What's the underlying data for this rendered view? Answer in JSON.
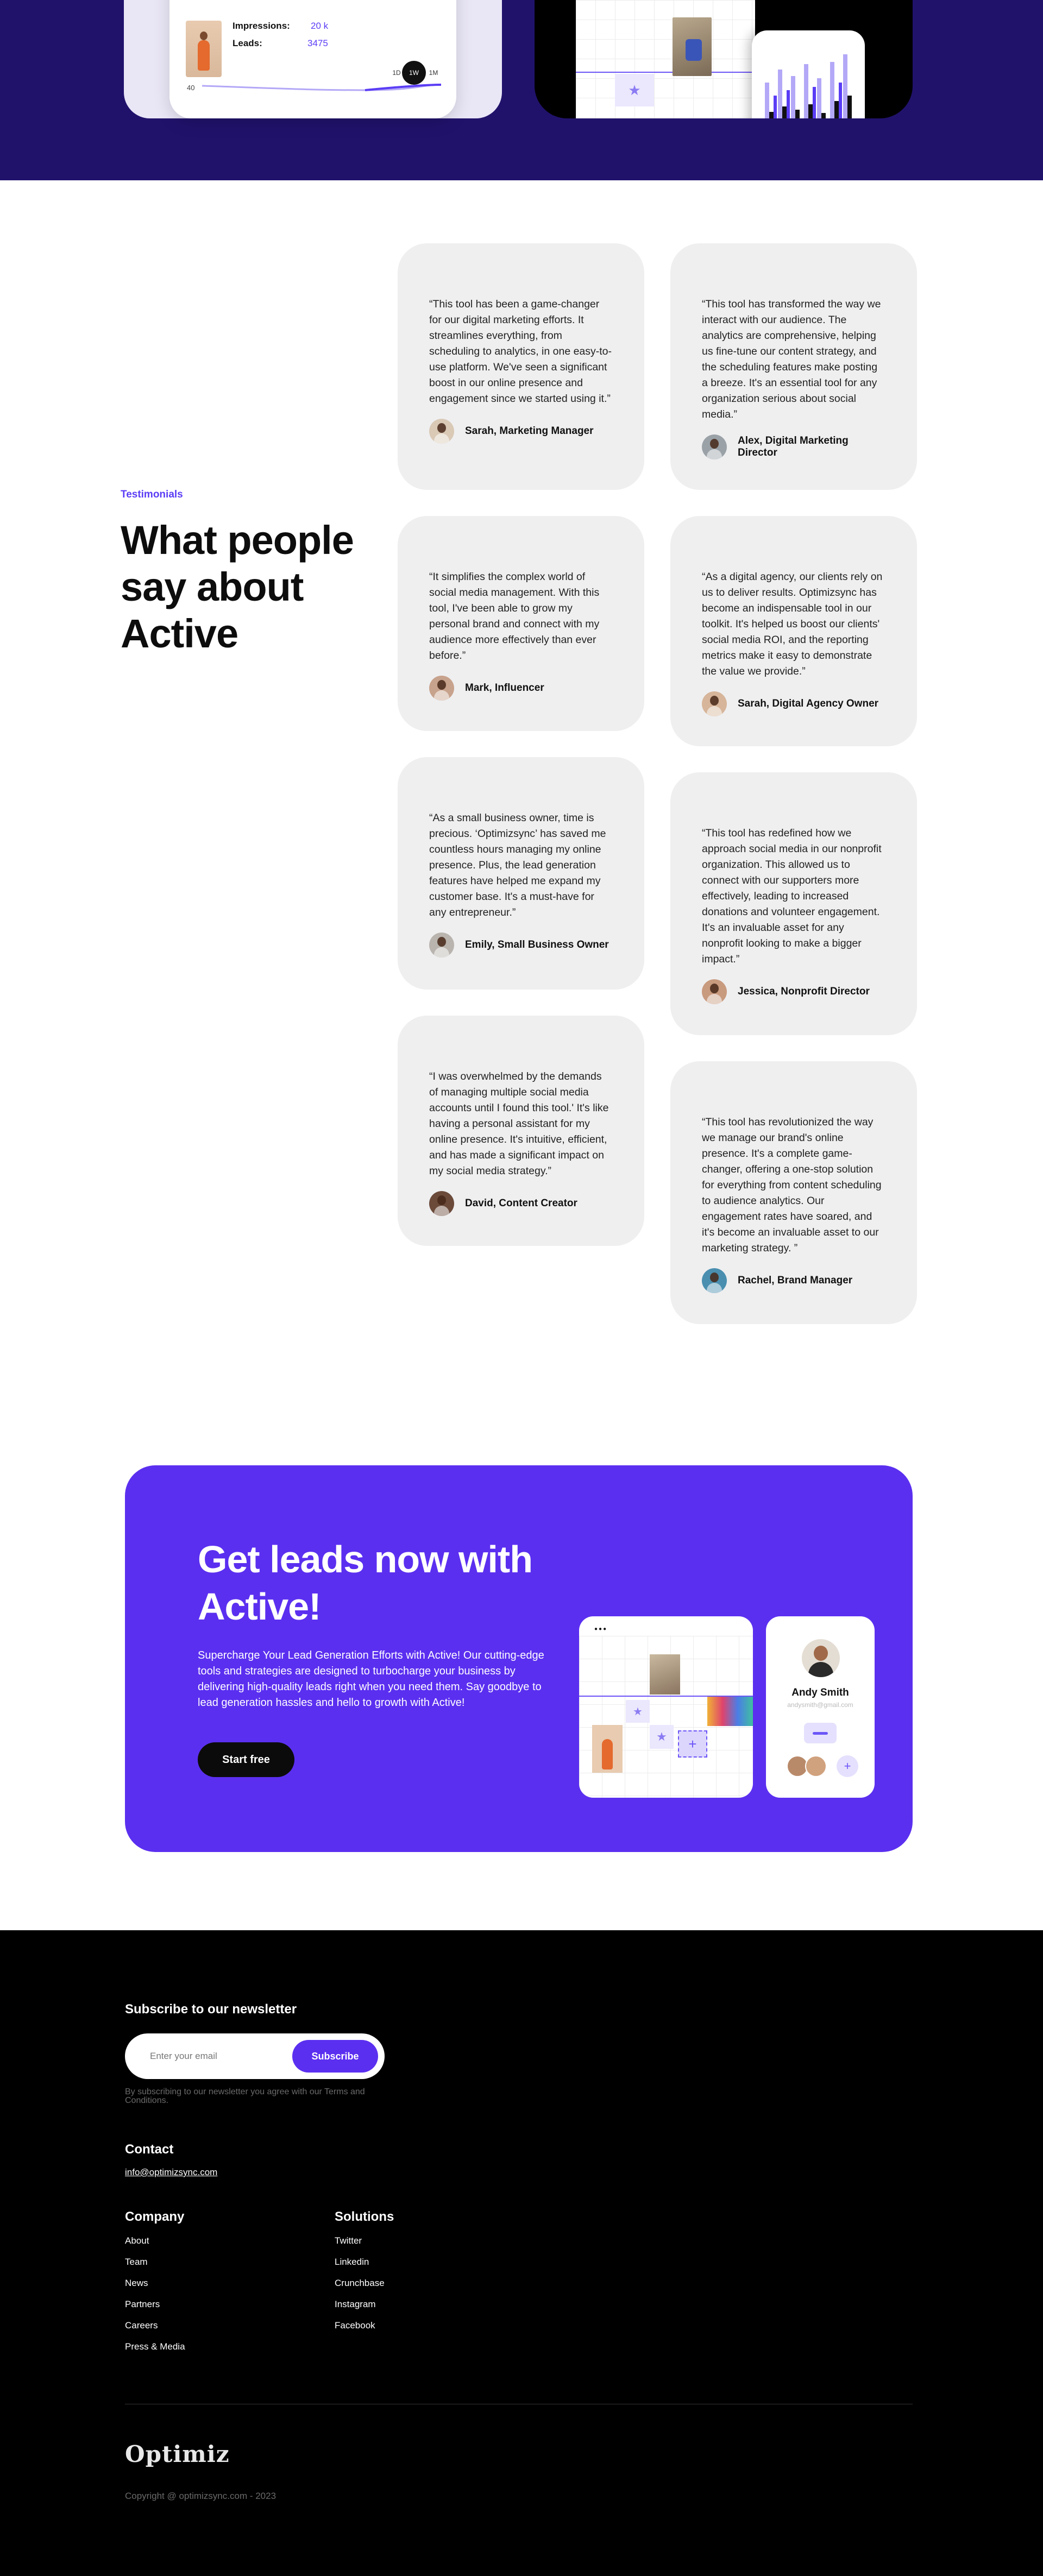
{
  "hero_preview": {
    "impressions_label": "Impressions:",
    "impressions_value": "20 k",
    "leads_label": "Leads:",
    "leads_value": "3475",
    "range_tabs": [
      "1D",
      "1W",
      "1M"
    ],
    "range_active": "1W",
    "axis_value": "40"
  },
  "testimonials": {
    "eyebrow": "Testimonials",
    "title": "What people say about Active",
    "items": [
      {
        "quote": "“This tool has been a game-changer for our digital marketing efforts. It streamlines everything, from scheduling to analytics, in one easy-to-use platform. We've seen a significant boost in our online presence and engagement since we started using it.”",
        "name": "Sarah, Marketing Manager",
        "avatar_color": "#d9c9b5"
      },
      {
        "quote": "“This tool has transformed the way we interact with our audience. The analytics are comprehensive, helping us fine-tune our content strategy, and the scheduling features make posting a breeze. It's an essential tool for any organization serious about social media.”",
        "name": "Alex, Digital Marketing Director",
        "avatar_color": "#9aa2a8"
      },
      {
        "quote": "“It simplifies the complex world of social media management. With this tool, I've been able to grow my personal brand and connect with my audience more effectively than ever before.”",
        "name": "Mark, Influencer",
        "avatar_color": "#c7a28c"
      },
      {
        "quote": "“As a digital agency, our clients rely on us to deliver results. Optimizsync has become an indispensable tool in our toolkit. It's helped us boost our clients' social media ROI, and the reporting metrics make it easy to demonstrate the value we provide.”",
        "name": "Sarah, Digital Agency Owner",
        "avatar_color": "#d6b59a"
      },
      {
        "quote": "“As a small business owner, time is precious. ‘Optimizsync’ has saved me countless hours managing my online presence. Plus, the lead generation features have helped me expand my customer base. It's a must-have for any entrepreneur.”",
        "name": "Emily, Small Business Owner",
        "avatar_color": "#b9b4ae"
      },
      {
        "quote": "“This tool has redefined how we approach social media in our nonprofit organization. This allowed us to connect with our supporters more effectively, leading to increased donations and volunteer engagement. It's an invaluable asset for any nonprofit looking to make a bigger impact.”",
        "name": "Jessica, Nonprofit Director",
        "avatar_color": "#c89a7e"
      },
      {
        "quote": "“I was overwhelmed by the demands of managing multiple social media accounts until I found this tool.' It's like having a personal assistant for my online presence. It's intuitive, efficient, and has made a significant impact on my social media strategy.”",
        "name": "David, Content Creator",
        "avatar_color": "#6b4a3a"
      },
      {
        "quote": "“This tool has revolutionized the way we manage our brand's online presence. It's a complete game-changer, offering a one-stop solution for everything from content scheduling to audience analytics. Our engagement rates have soared, and it's become an invaluable asset to our marketing strategy. ”",
        "name": "Rachel, Brand Manager",
        "avatar_color": "#4a8fb0"
      }
    ]
  },
  "cta": {
    "title": "Get leads now with Active!",
    "text": "Supercharge Your Lead Generation Efforts with Active! Our cutting-edge tools and strategies are designed to turbocharge your business by delivering high-quality leads right when you need them. Say goodbye to lead generation hassles and hello to growth with Active!",
    "button": "Start free",
    "profile_name": "Andy Smith",
    "profile_email": "andysmith@gmail.com",
    "window_dots": "●●●"
  },
  "footer": {
    "newsletter_title": "Subscribe to our newsletter",
    "email_placeholder": "Enter your email",
    "subscribe_button": "Subscribe",
    "note": "By subscribing to our newsletter you agree with our Terms and Conditions.",
    "contact_title": "Contact",
    "contact_email": "info@optimizsync.com",
    "company_title": "Company",
    "company_links": [
      "About",
      "Team",
      "News",
      "Partners",
      "Careers",
      "Press & Media"
    ],
    "solutions_title": "Solutions",
    "solutions_links": [
      "Twitter",
      "Linkedin",
      "Crunchbase",
      "Instagram",
      "Facebook"
    ],
    "logo": "Optimiz",
    "copyright": "Copyright @ optimizsync.com - 2023"
  },
  "colors": {
    "brand_purple": "#5b2ff0",
    "dark_navy": "#20126b",
    "card_grey": "#efeff0"
  }
}
